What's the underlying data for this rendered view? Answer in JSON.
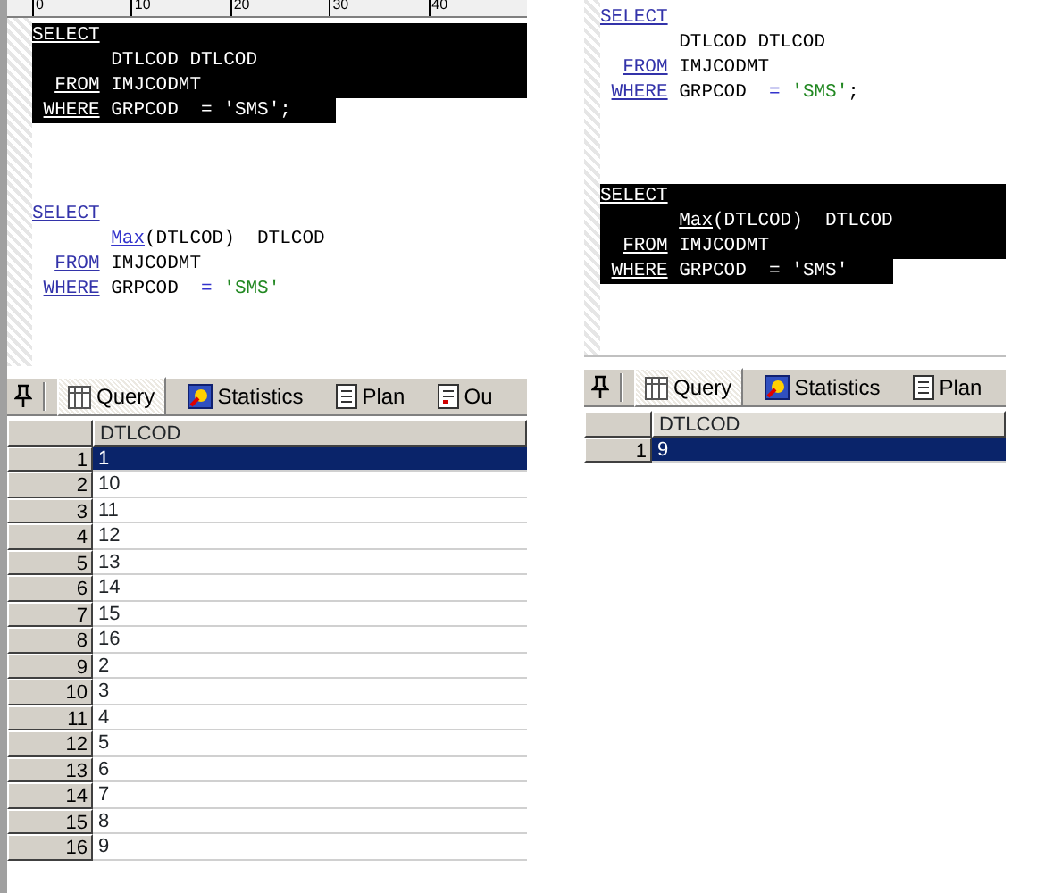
{
  "panels": [
    {
      "ruler": {
        "labels": [
          "0",
          "10",
          "20",
          "30",
          "40"
        ]
      },
      "editor": {
        "blocks": [
          {
            "selected": true,
            "lines": [
              {
                "keyword": "SELECT"
              },
              {
                "tokens": [
                  {
                    "kind": "ident",
                    "text": "DTLCOD DTLCOD"
                  }
                ]
              },
              {
                "keyword": "FROM",
                "tokens": [
                  {
                    "kind": "ident",
                    "text": "IMJCODMT"
                  }
                ]
              },
              {
                "keyword": "WHERE",
                "tokens": [
                  {
                    "kind": "ident",
                    "text": "GRPCOD"
                  },
                  {
                    "kind": "operator",
                    "text": "="
                  },
                  {
                    "kind": "string",
                    "text": "'SMS'"
                  },
                  {
                    "kind": "punct",
                    "text": ";"
                  }
                ]
              }
            ]
          },
          {
            "selected": false,
            "lines": [
              {
                "keyword": "SELECT"
              },
              {
                "tokens": [
                  {
                    "kind": "func",
                    "text": "Max"
                  },
                  {
                    "kind": "ident",
                    "text": "(DTLCOD)  DTLCOD"
                  }
                ]
              },
              {
                "keyword": "FROM",
                "tokens": [
                  {
                    "kind": "ident",
                    "text": "IMJCODMT"
                  }
                ]
              },
              {
                "keyword": "WHERE",
                "tokens": [
                  {
                    "kind": "ident",
                    "text": "GRPCOD"
                  },
                  {
                    "kind": "operator",
                    "text": "="
                  },
                  {
                    "kind": "string",
                    "text": "'SMS'"
                  }
                ]
              }
            ]
          }
        ]
      },
      "tabs": [
        {
          "kind": "query",
          "label": "Query",
          "selected": true
        },
        {
          "kind": "statistics",
          "label": "Statistics",
          "selected": false
        },
        {
          "kind": "plan",
          "label": "Plan",
          "selected": false
        },
        {
          "kind": "output",
          "label": "Ou",
          "selected": false
        }
      ],
      "grid": {
        "columns": [
          "DTLCOD"
        ],
        "rows": [
          {
            "number": "1",
            "values": [
              "1"
            ],
            "selected": true
          },
          {
            "number": "2",
            "values": [
              "10"
            ],
            "selected": false
          },
          {
            "number": "3",
            "values": [
              "11"
            ],
            "selected": false
          },
          {
            "number": "4",
            "values": [
              "12"
            ],
            "selected": false
          },
          {
            "number": "5",
            "values": [
              "13"
            ],
            "selected": false
          },
          {
            "number": "6",
            "values": [
              "14"
            ],
            "selected": false
          },
          {
            "number": "7",
            "values": [
              "15"
            ],
            "selected": false
          },
          {
            "number": "8",
            "values": [
              "16"
            ],
            "selected": false
          },
          {
            "number": "9",
            "values": [
              "2"
            ],
            "selected": false
          },
          {
            "number": "10",
            "values": [
              "3"
            ],
            "selected": false
          },
          {
            "number": "11",
            "values": [
              "4"
            ],
            "selected": false
          },
          {
            "number": "12",
            "values": [
              "5"
            ],
            "selected": false
          },
          {
            "number": "13",
            "values": [
              "6"
            ],
            "selected": false
          },
          {
            "number": "14",
            "values": [
              "7"
            ],
            "selected": false
          },
          {
            "number": "15",
            "values": [
              "8"
            ],
            "selected": false
          },
          {
            "number": "16",
            "values": [
              "9"
            ],
            "selected": false
          }
        ]
      }
    },
    {
      "editor": {
        "blocks": [
          {
            "selected": false,
            "lines": [
              {
                "keyword": "SELECT"
              },
              {
                "tokens": [
                  {
                    "kind": "ident",
                    "text": "DTLCOD DTLCOD"
                  }
                ]
              },
              {
                "keyword": "FROM",
                "tokens": [
                  {
                    "kind": "ident",
                    "text": "IMJCODMT"
                  }
                ]
              },
              {
                "keyword": "WHERE",
                "tokens": [
                  {
                    "kind": "ident",
                    "text": "GRPCOD"
                  },
                  {
                    "kind": "operator",
                    "text": "="
                  },
                  {
                    "kind": "string",
                    "text": "'SMS'"
                  },
                  {
                    "kind": "punct",
                    "text": ";"
                  }
                ]
              }
            ]
          },
          {
            "selected": true,
            "lines": [
              {
                "keyword": "SELECT"
              },
              {
                "tokens": [
                  {
                    "kind": "func",
                    "text": "Max"
                  },
                  {
                    "kind": "ident",
                    "text": "(DTLCOD)  DTLCOD"
                  }
                ]
              },
              {
                "keyword": "FROM",
                "tokens": [
                  {
                    "kind": "ident",
                    "text": "IMJCODMT"
                  }
                ]
              },
              {
                "keyword": "WHERE",
                "tokens": [
                  {
                    "kind": "ident",
                    "text": "GRPCOD"
                  },
                  {
                    "kind": "operator",
                    "text": "="
                  },
                  {
                    "kind": "string",
                    "text": "'SMS'"
                  }
                ]
              }
            ]
          }
        ]
      },
      "tabs": [
        {
          "kind": "query",
          "label": "Query",
          "selected": true
        },
        {
          "kind": "statistics",
          "label": "Statistics",
          "selected": false
        },
        {
          "kind": "plan",
          "label": "Plan",
          "selected": false
        }
      ],
      "grid": {
        "columns": [
          "DTLCOD"
        ],
        "rows": [
          {
            "number": "1",
            "values": [
              "9"
            ],
            "selected": true
          }
        ]
      }
    }
  ]
}
